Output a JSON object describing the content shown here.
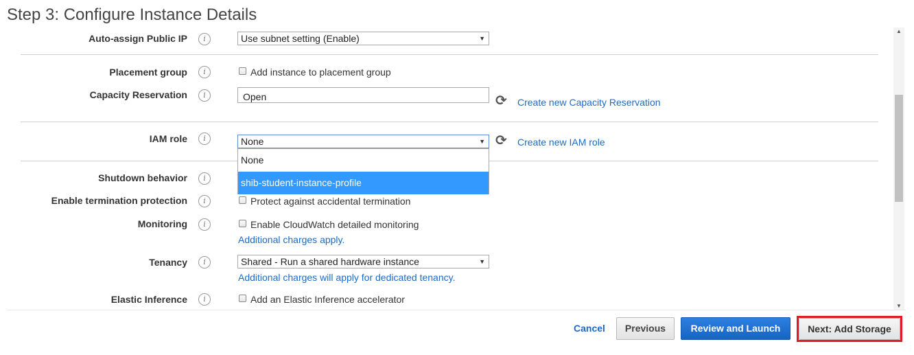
{
  "page": {
    "title": "Step 3: Configure Instance Details"
  },
  "fields": {
    "auto_assign_ip": {
      "label": "Auto-assign Public IP",
      "value": "Use subnet setting (Enable)"
    },
    "placement_group": {
      "label": "Placement group",
      "checkbox_label": "Add instance to placement group",
      "checked": false
    },
    "capacity_reservation": {
      "label": "Capacity Reservation",
      "value": "Open",
      "link": "Create new Capacity Reservation"
    },
    "iam_role": {
      "label": "IAM role",
      "value": "None",
      "link": "Create new IAM role",
      "options": [
        "None",
        "shib-student-instance-profile"
      ],
      "highlighted_option": "shib-student-instance-profile"
    },
    "shutdown_behavior": {
      "label": "Shutdown behavior"
    },
    "termination_protection": {
      "label": "Enable termination protection",
      "checkbox_label": "Protect against accidental termination",
      "checked": false
    },
    "monitoring": {
      "label": "Monitoring",
      "checkbox_label": "Enable CloudWatch detailed monitoring",
      "checked": false,
      "note_link": "Additional charges apply."
    },
    "tenancy": {
      "label": "Tenancy",
      "value": "Shared - Run a shared hardware instance",
      "note_link": "Additional charges will apply for dedicated tenancy."
    },
    "elastic_inference": {
      "label": "Elastic Inference",
      "checkbox_label": "Add an Elastic Inference accelerator",
      "checked": false
    }
  },
  "icons": {
    "info": "i",
    "refresh": "⟳",
    "dropdown_arrow": "▼",
    "scroll_up": "▲",
    "scroll_down": "▼"
  },
  "footer": {
    "cancel_label": "Cancel",
    "previous_label": "Previous",
    "review_label": "Review and Launch",
    "next_label": "Next: Add Storage"
  },
  "colors": {
    "link": "#1b6ac9",
    "primary_button": "#1f72d2",
    "highlight_border": "#e01b24",
    "dropdown_selected": "#3399ff"
  }
}
